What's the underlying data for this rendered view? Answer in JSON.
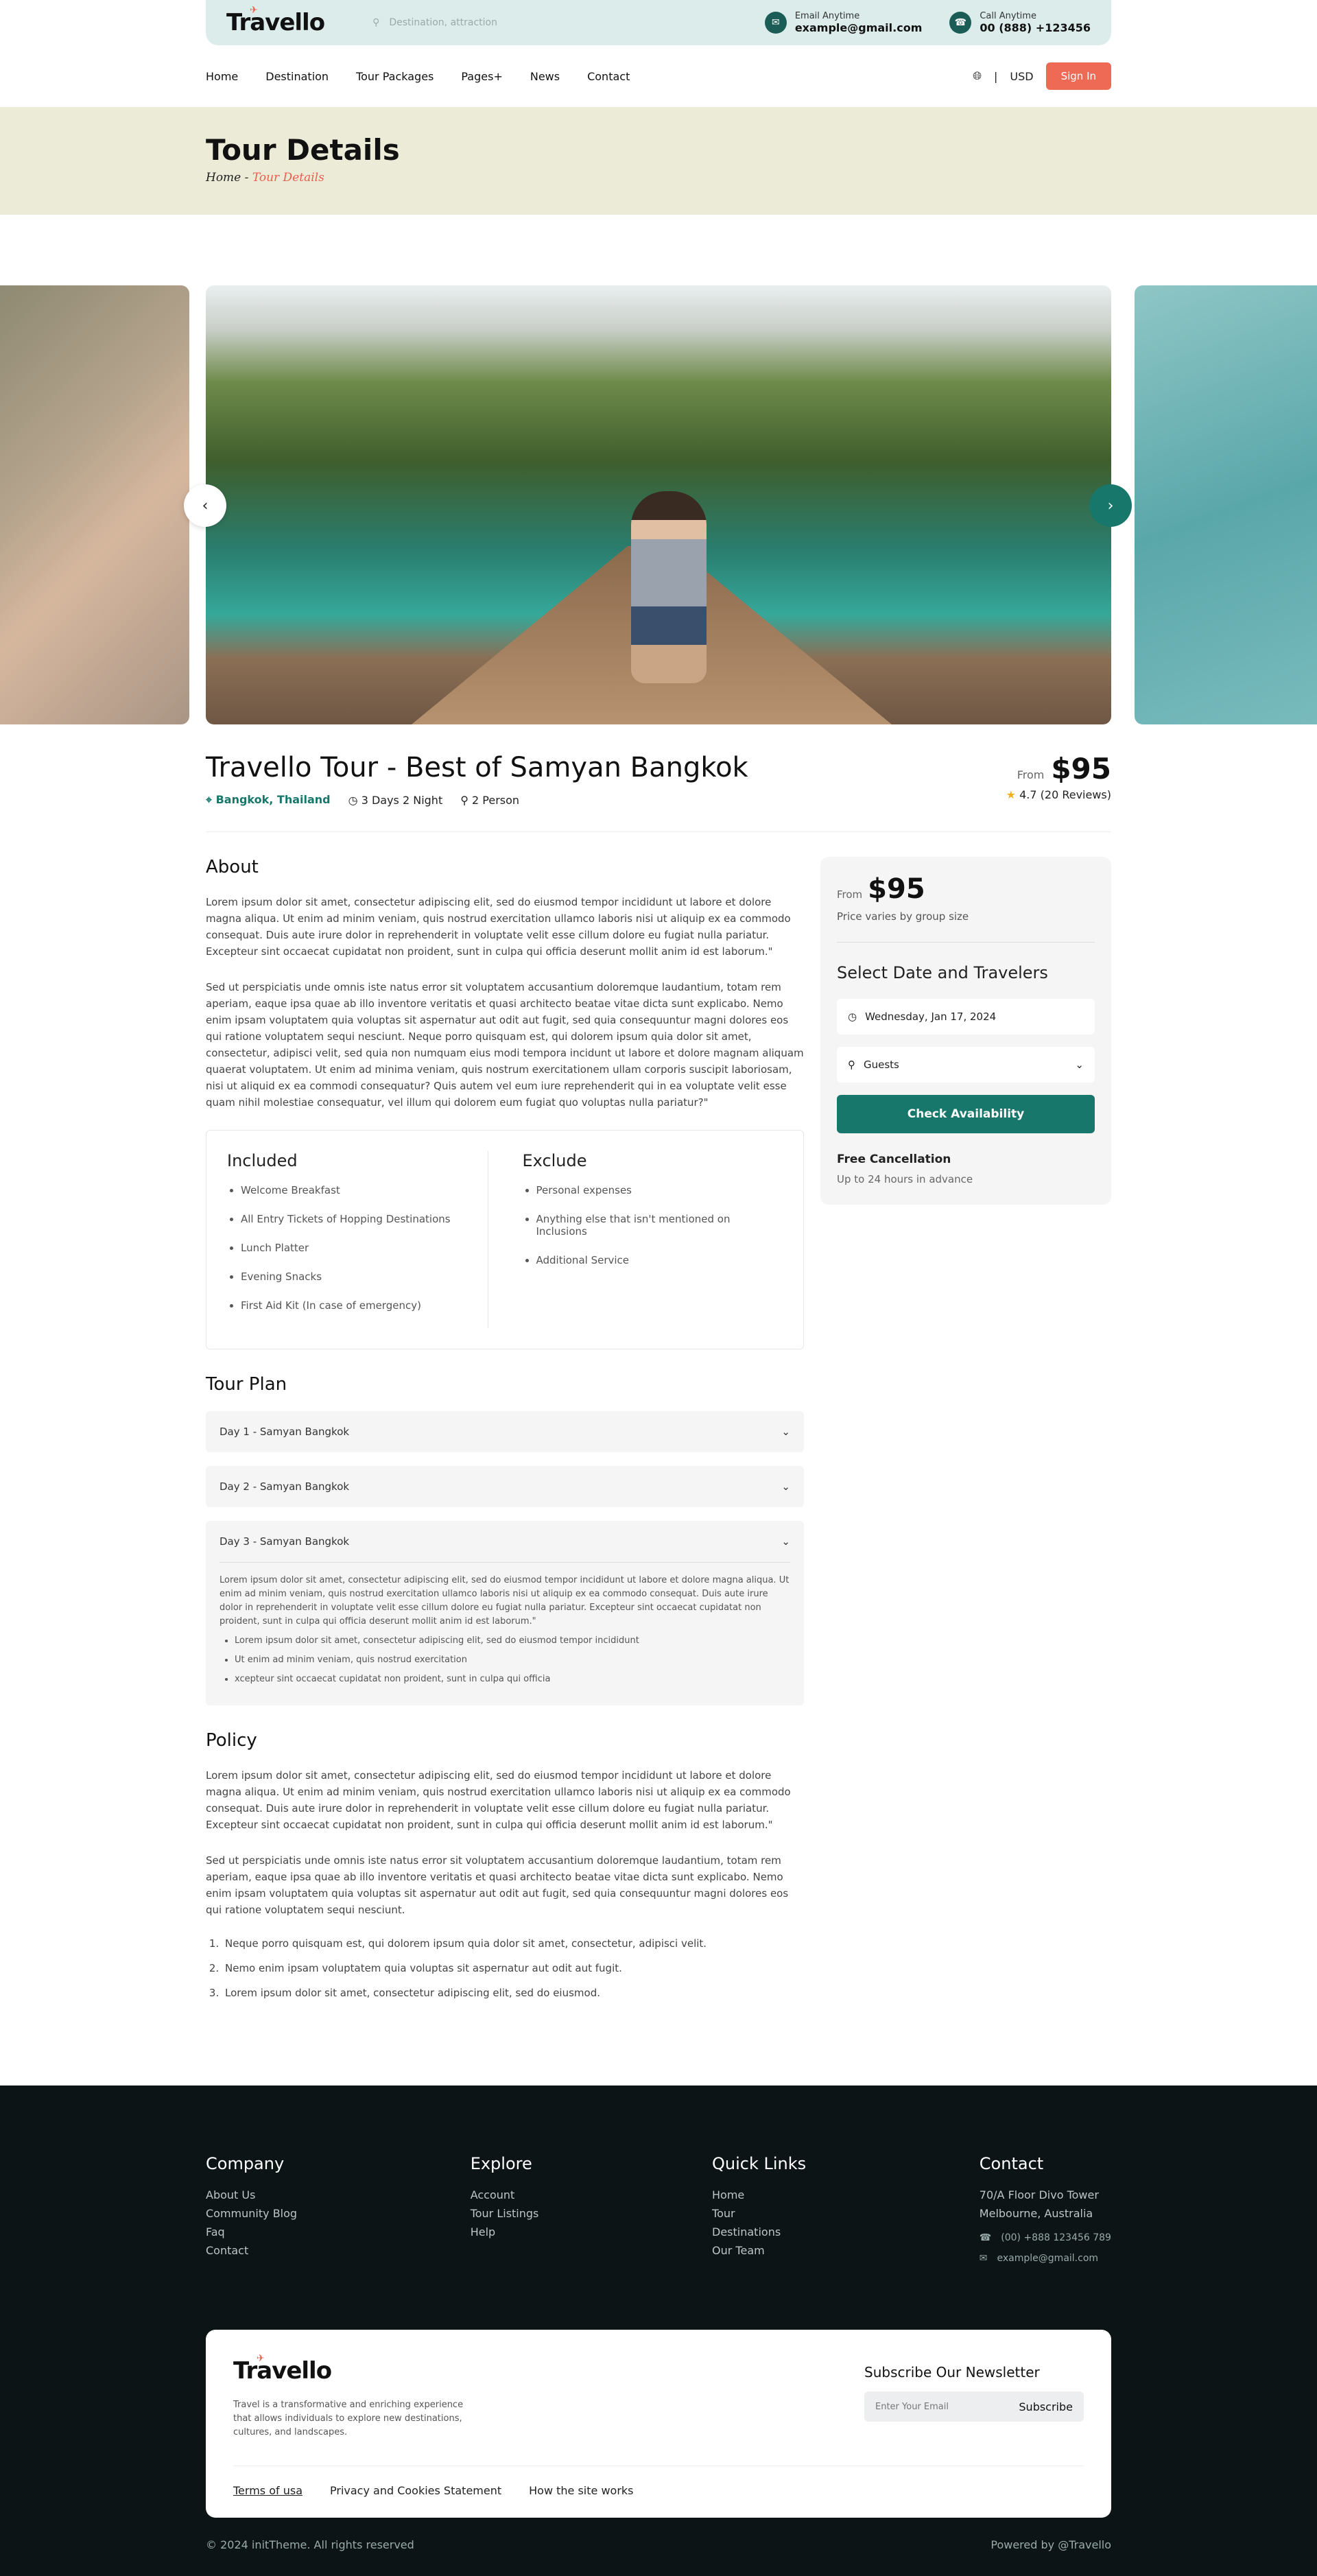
{
  "brand": {
    "name": "Travello"
  },
  "topbar": {
    "search_placeholder": "Destination, attraction",
    "email_label": "Email Anytime",
    "email": "example@gmail.com",
    "call_label": "Call Anytime",
    "phone": "00 (888) +123456"
  },
  "nav": {
    "items": [
      "Home",
      "Destination",
      "Tour Packages",
      "Pages+",
      "News",
      "Contact"
    ],
    "currency": "USD",
    "signin": "Sign In"
  },
  "banner": {
    "title": "Tour Details",
    "crumb_home": "Home",
    "crumb_sep": " - ",
    "crumb_current": "Tour Details"
  },
  "tour": {
    "title": "Travello Tour - Best of Samyan Bangkok",
    "location": "Bangkok, Thailand",
    "duration": "3 Days 2 Night",
    "people": "2 Person",
    "from": "From",
    "price": "$95",
    "rating": "4.7 (20 Reviews)"
  },
  "about": {
    "heading": "About",
    "p1": "Lorem ipsum dolor sit amet, consectetur adipiscing elit, sed do eiusmod tempor incididunt ut labore et dolore magna aliqua. Ut enim ad minim veniam, quis nostrud exercitation ullamco laboris nisi ut aliquip ex ea commodo consequat. Duis aute irure dolor in reprehenderit in voluptate velit esse cillum dolore eu fugiat nulla pariatur. Excepteur sint occaecat cupidatat non proident, sunt in culpa qui officia deserunt mollit anim id est laborum.\"",
    "p2": "Sed ut perspiciatis unde omnis iste natus error sit voluptatem accusantium doloremque laudantium, totam rem aperiam, eaque ipsa quae ab illo inventore veritatis et quasi architecto beatae vitae dicta sunt explicabo. Nemo enim ipsam voluptatem quia voluptas sit aspernatur aut odit aut fugit, sed quia consequuntur magni dolores eos qui ratione voluptatem sequi nesciunt. Neque porro quisquam est, qui dolorem ipsum quia dolor sit amet, consectetur, adipisci velit, sed quia non numquam eius modi tempora incidunt ut labore et dolore magnam aliquam quaerat voluptatem. Ut enim ad minima veniam, quis nostrum exercitationem ullam corporis suscipit laboriosam, nisi ut aliquid ex ea commodi consequatur? Quis autem vel eum iure reprehenderit qui in ea voluptate velit esse quam nihil molestiae consequatur, vel illum qui dolorem eum fugiat quo voluptas nulla pariatur?\""
  },
  "included": {
    "heading": "Included",
    "items": [
      "Welcome Breakfast",
      "All Entry Tickets of Hopping Destinations",
      "Lunch Platter",
      "Evening Snacks",
      "First Aid Kit (In case of emergency)"
    ]
  },
  "exclude": {
    "heading": "Exclude",
    "items": [
      "Personal expenses",
      "Anything else that isn't mentioned on Inclusions",
      "Additional Service"
    ]
  },
  "plan": {
    "heading": "Tour Plan",
    "days": [
      "Day 1 - Samyan Bangkok",
      "Day 2 - Samyan Bangkok",
      "Day 3 - Samyan Bangkok"
    ],
    "day3_text": "Lorem ipsum dolor sit amet, consectetur adipiscing elit, sed do eiusmod tempor incididunt ut labore et dolore magna aliqua. Ut enim ad minim veniam, quis nostrud exercitation ullamco laboris nisi ut aliquip ex ea commodo consequat. Duis aute irure dolor in reprehenderit in voluptate velit esse cillum dolore eu fugiat nulla pariatur. Excepteur sint occaecat cupidatat non proident, sunt in culpa qui officia deserunt mollit anim id est laborum.\"",
    "day3_items": [
      "Lorem ipsum dolor sit amet, consectetur adipiscing elit, sed do eiusmod tempor incididunt",
      "Ut enim ad minim veniam, quis nostrud exercitation",
      "xcepteur sint occaecat cupidatat non proident, sunt in culpa qui officia"
    ]
  },
  "policy": {
    "heading": "Policy",
    "p1": "Lorem ipsum dolor sit amet, consectetur adipiscing elit, sed do eiusmod tempor incididunt ut labore et dolore magna aliqua. Ut enim ad minim veniam, quis nostrud exercitation ullamco laboris nisi ut aliquip ex ea commodo consequat. Duis aute irure dolor in reprehenderit in voluptate velit esse cillum dolore eu fugiat nulla pariatur. Excepteur sint occaecat cupidatat non proident, sunt in culpa qui officia deserunt mollit anim id est laborum.\"",
    "p2": "Sed ut perspiciatis unde omnis iste natus error sit voluptatem accusantium doloremque laudantium, totam rem aperiam, eaque ipsa quae ab illo inventore veritatis et quasi architecto beatae vitae dicta sunt explicabo. Nemo enim ipsam voluptatem quia voluptas sit aspernatur aut odit aut fugit, sed quia consequuntur magni dolores eos qui ratione voluptatem sequi nesciunt.",
    "items": [
      "Neque porro quisquam est, qui dolorem ipsum quia dolor sit amet, consectetur, adipisci velit.",
      "Nemo enim ipsam voluptatem quia voluptas sit aspernatur aut odit aut fugit.",
      "Lorem ipsum dolor sit amet, consectetur adipiscing elit, sed do eiusmod."
    ]
  },
  "booking": {
    "from": "From",
    "price": "$95",
    "note": "Price varies by group size",
    "heading": "Select Date and Travelers",
    "date": "Wednesday, Jan 17, 2024",
    "guests": "Guests",
    "button": "Check Availability",
    "cancel_title": "Free Cancellation",
    "cancel_note": "Up to 24 hours in advance"
  },
  "footer": {
    "company": {
      "heading": "Company",
      "links": [
        "About Us",
        "Community Blog",
        "Faq",
        "Contact"
      ]
    },
    "explore": {
      "heading": "Explore",
      "links": [
        "Account",
        "Tour Listings",
        "Help"
      ]
    },
    "quick": {
      "heading": "Quick Links",
      "links": [
        "Home",
        "Tour",
        "Destinations",
        "Our Team"
      ]
    },
    "contact": {
      "heading": "Contact",
      "address1": "70/A Floor Divo Tower",
      "address2": "Melbourne, Australia",
      "phone": "(00) +888 123456 789",
      "email": "example@gmail.com"
    },
    "card": {
      "desc": "Travel is a transformative and enriching experience that allows individuals to explore new destinations, cultures, and landscapes.",
      "news_heading": "Subscribe Our Newsletter",
      "news_placeholder": "Enter Your Email",
      "news_button": "Subscribe",
      "links": [
        "Terms of usa",
        "Privacy and Cookies Statement",
        "How the site works"
      ]
    },
    "copyright": "© 2024 initTheme. All rights reserved",
    "powered": "Powered by @Travello"
  },
  "colors": {
    "primary": "#17776b",
    "accent": "#ef6a55",
    "banner": "#ecebd8",
    "footer": "#0c1416"
  }
}
